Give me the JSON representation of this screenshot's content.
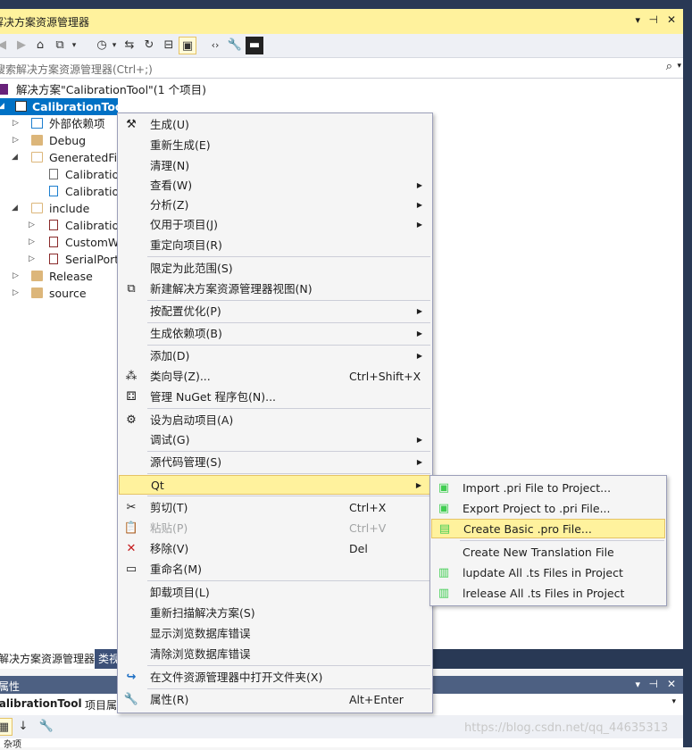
{
  "panel": {
    "title": "解决方案资源管理器",
    "pin_glyph": "▾ ⊣ ✕"
  },
  "search": {
    "placeholder": "搜索解决方案资源管理器(Ctrl+;)",
    "icon": "search-icon"
  },
  "tree": {
    "solution": "解决方案\"CalibrationTool\"(1 个项目)",
    "project": "CalibrationTool",
    "items": [
      {
        "label": "外部依赖项"
      },
      {
        "label": "Debug"
      },
      {
        "label": "GeneratedFile"
      },
      {
        "label": "Calibration"
      },
      {
        "label": "Calibration"
      },
      {
        "label": "include"
      },
      {
        "label": "Calibration"
      },
      {
        "label": "CustomWi"
      },
      {
        "label": "SerialPort."
      },
      {
        "label": "Release"
      },
      {
        "label": "source"
      }
    ]
  },
  "context_menu": {
    "items": [
      {
        "label": "生成(U)"
      },
      {
        "label": "重新生成(E)"
      },
      {
        "label": "清理(N)"
      },
      {
        "label": "查看(W)"
      },
      {
        "label": "分析(Z)"
      },
      {
        "label": "仅用于项目(J)"
      },
      {
        "label": "重定向项目(R)"
      },
      {
        "label": "限定为此范围(S)"
      },
      {
        "label": "新建解决方案资源管理器视图(N)"
      },
      {
        "label": "按配置优化(P)"
      },
      {
        "label": "生成依赖项(B)"
      },
      {
        "label": "添加(D)"
      },
      {
        "label": "类向导(Z)...",
        "shortcut": "Ctrl+Shift+X"
      },
      {
        "label": "管理 NuGet 程序包(N)..."
      },
      {
        "label": "设为启动项目(A)"
      },
      {
        "label": "调试(G)"
      },
      {
        "label": "源代码管理(S)"
      },
      {
        "label": "Qt"
      },
      {
        "label": "剪切(T)",
        "shortcut": "Ctrl+X"
      },
      {
        "label": "粘贴(P)",
        "shortcut": "Ctrl+V"
      },
      {
        "label": "移除(V)",
        "shortcut": "Del"
      },
      {
        "label": "重命名(M)"
      },
      {
        "label": "卸载项目(L)"
      },
      {
        "label": "重新扫描解决方案(S)"
      },
      {
        "label": "显示浏览数据库错误"
      },
      {
        "label": "清除浏览数据库错误"
      },
      {
        "label": "在文件资源管理器中打开文件夹(X)"
      },
      {
        "label": "属性(R)",
        "shortcut": "Alt+Enter"
      }
    ]
  },
  "qt_submenu": {
    "items": [
      {
        "label": "Import .pri File to Project..."
      },
      {
        "label": "Export Project to .pri File..."
      },
      {
        "label": "Create Basic .pro File..."
      },
      {
        "label": "Create New Translation File"
      },
      {
        "label": "lupdate All .ts Files in Project"
      },
      {
        "label": "lrelease All .ts Files in Project"
      }
    ]
  },
  "bottom_tabs": {
    "active": "解决方案资源管理器",
    "inactive": "类视"
  },
  "properties": {
    "title": "属性",
    "object": "CalibrationTool",
    "object_suffix": "项目属",
    "row": "杂项"
  },
  "watermark": "https://blog.csdn.net/qq_44635313",
  "colors": {
    "frame": "#293955",
    "title_bg": "#fff29d",
    "selection": "#0071c5",
    "highlight": "#fff29d",
    "folder": "#dcb67a"
  }
}
